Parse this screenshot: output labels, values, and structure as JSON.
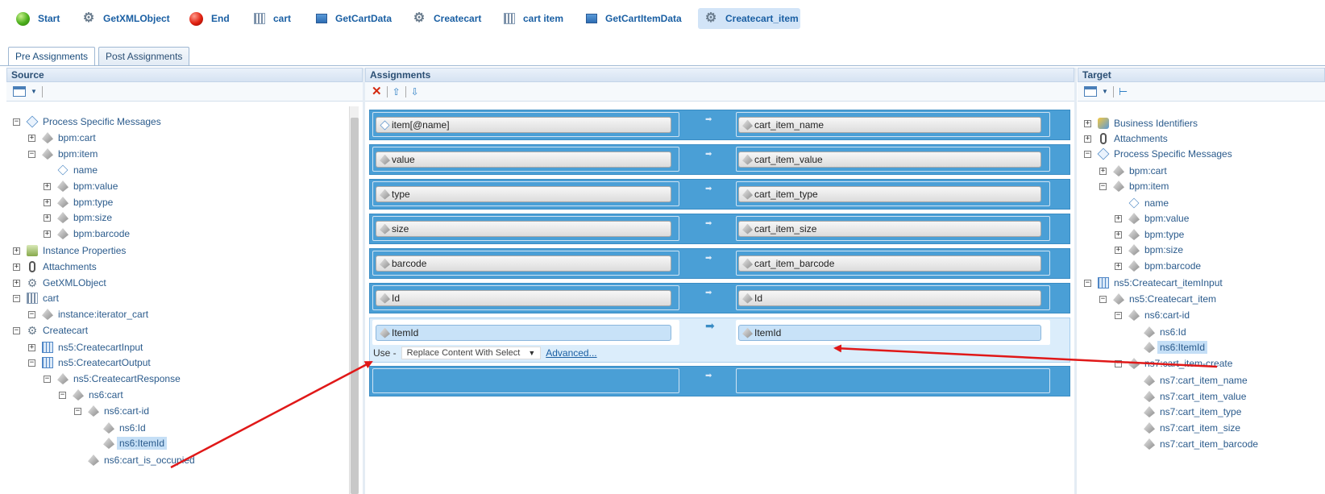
{
  "toolbar": {
    "items": [
      {
        "label": "Start",
        "icon": "start-circle-icon"
      },
      {
        "label": "GetXMLObject",
        "icon": "gear-icon"
      },
      {
        "label": "End",
        "icon": "end-circle-icon"
      },
      {
        "label": "cart",
        "icon": "loop-bars-icon"
      },
      {
        "label": "GetCartData",
        "icon": "data-icon"
      },
      {
        "label": "Createcart",
        "icon": "gear-icon"
      },
      {
        "label": "cart item",
        "icon": "loop-bars-icon"
      },
      {
        "label": "GetCartItemData",
        "icon": "data-icon"
      },
      {
        "label": "Createcart_item",
        "icon": "gear-icon"
      }
    ],
    "selected": "Createcart_item"
  },
  "tabs": {
    "pre": "Pre Assignments",
    "post": "Post Assignments",
    "active": "Pre Assignments"
  },
  "source": {
    "title": "Source",
    "nodes": [
      {
        "label": "Process Specific Messages",
        "expander": "−",
        "icon": "message-icon"
      },
      {
        "label": "bpm:cart",
        "expander": "+",
        "icon": "element-icon"
      },
      {
        "label": "bpm:item",
        "expander": "−",
        "icon": "element-icon"
      },
      {
        "label": "name",
        "expander": "",
        "icon": "attribute-icon"
      },
      {
        "label": "bpm:value",
        "expander": "+",
        "icon": "element-icon"
      },
      {
        "label": "bpm:type",
        "expander": "+",
        "icon": "element-icon"
      },
      {
        "label": "bpm:size",
        "expander": "+",
        "icon": "element-icon"
      },
      {
        "label": "bpm:barcode",
        "expander": "+",
        "icon": "element-icon"
      },
      {
        "label": "Instance Properties",
        "expander": "+",
        "icon": "instance-icon"
      },
      {
        "label": "Attachments",
        "expander": "+",
        "icon": "attachment-icon"
      },
      {
        "label": "GetXMLObject",
        "expander": "+",
        "icon": "gear-icon"
      },
      {
        "label": "cart",
        "expander": "−",
        "icon": "loop-bars-icon"
      },
      {
        "label": "instance:iterator_cart",
        "expander": "−",
        "icon": "element-icon"
      },
      {
        "label": "Createcart",
        "expander": "−",
        "icon": "gear-icon"
      },
      {
        "label": "ns5:CreatecartInput",
        "expander": "+",
        "icon": "grid-icon"
      },
      {
        "label": "ns5:CreatecartOutput",
        "expander": "−",
        "icon": "grid-icon"
      },
      {
        "label": "ns5:CreatecartResponse",
        "expander": "−",
        "icon": "element-icon"
      },
      {
        "label": "ns6:cart",
        "expander": "−",
        "icon": "element-icon"
      },
      {
        "label": "ns6:cart-id",
        "expander": "−",
        "icon": "element-icon"
      },
      {
        "label": "ns6:Id",
        "expander": "",
        "icon": "element-icon"
      },
      {
        "label": "ns6:ItemId",
        "expander": "",
        "icon": "element-icon",
        "highlighted": true
      },
      {
        "label": "ns6:cart_is_occupied",
        "expander": "",
        "icon": "element-icon"
      }
    ]
  },
  "assignments": {
    "title": "Assignments",
    "rows": [
      {
        "source": "item[@name]",
        "target": "cart_item_name",
        "source_icon": "attribute-icon"
      },
      {
        "source": "value",
        "target": "cart_item_value",
        "source_icon": "element-icon"
      },
      {
        "source": "type",
        "target": "cart_item_type",
        "source_icon": "element-icon"
      },
      {
        "source": "size",
        "target": "cart_item_size",
        "source_icon": "element-icon"
      },
      {
        "source": "barcode",
        "target": "cart_item_barcode",
        "source_icon": "element-icon"
      },
      {
        "source": "Id",
        "target": "Id",
        "source_icon": "element-icon"
      },
      {
        "source": "ItemId",
        "target": "ItemId",
        "source_icon": "element-icon",
        "selected": true
      },
      {
        "source": "",
        "target": "",
        "source_icon": ""
      }
    ],
    "use_label": "Use -",
    "use_option": "Replace Content With Select",
    "advanced_link": "Advanced..."
  },
  "target": {
    "title": "Target",
    "nodes": [
      {
        "label": "Business Identifiers",
        "expander": "+",
        "icon": "business-icon"
      },
      {
        "label": "Attachments",
        "expander": "+",
        "icon": "attachment-icon"
      },
      {
        "label": "Process Specific Messages",
        "expander": "−",
        "icon": "message-icon"
      },
      {
        "label": "bpm:cart",
        "expander": "+",
        "icon": "element-icon"
      },
      {
        "label": "bpm:item",
        "expander": "−",
        "icon": "element-icon"
      },
      {
        "label": "name",
        "expander": "",
        "icon": "attribute-icon"
      },
      {
        "label": "bpm:value",
        "expander": "+",
        "icon": "element-icon"
      },
      {
        "label": "bpm:type",
        "expander": "+",
        "icon": "element-icon"
      },
      {
        "label": "bpm:size",
        "expander": "+",
        "icon": "element-icon"
      },
      {
        "label": "bpm:barcode",
        "expander": "+",
        "icon": "element-icon"
      },
      {
        "label": "ns5:Createcart_itemInput",
        "expander": "−",
        "icon": "grid-icon"
      },
      {
        "label": "ns5:Createcart_item",
        "expander": "−",
        "icon": "element-icon"
      },
      {
        "label": "ns6:cart-id",
        "expander": "−",
        "icon": "element-icon"
      },
      {
        "label": "ns6:Id",
        "expander": "",
        "icon": "element-icon"
      },
      {
        "label": "ns6:ItemId",
        "expander": "",
        "icon": "element-icon",
        "highlighted": true
      },
      {
        "label": "ns7:cart_item-create",
        "expander": "−",
        "icon": "element-icon"
      },
      {
        "label": "ns7:cart_item_name",
        "expander": "",
        "icon": "element-icon"
      },
      {
        "label": "ns7:cart_item_value",
        "expander": "",
        "icon": "element-icon"
      },
      {
        "label": "ns7:cart_item_type",
        "expander": "",
        "icon": "element-icon"
      },
      {
        "label": "ns7:cart_item_size",
        "expander": "",
        "icon": "element-icon"
      },
      {
        "label": "ns7:cart_item_barcode",
        "expander": "",
        "icon": "element-icon"
      }
    ]
  },
  "colors": {
    "accent": "#1a5fa3",
    "row_blue": "#4a9fd6",
    "arrow_red": "#e01818",
    "highlight": "#c5dff6"
  }
}
